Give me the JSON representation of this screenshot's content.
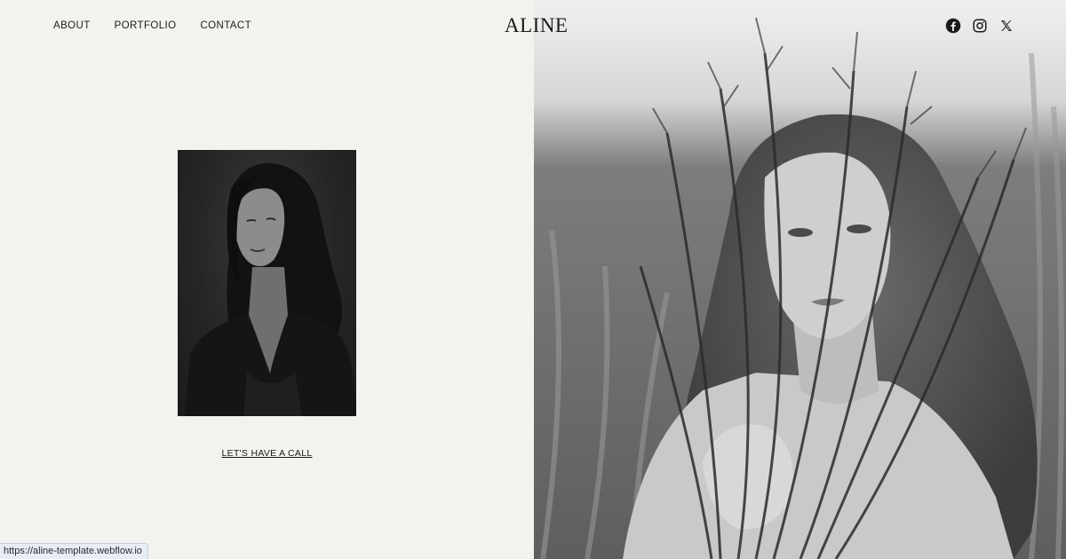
{
  "nav": {
    "items": [
      {
        "label": "ABOUT"
      },
      {
        "label": "PORTFOLIO"
      },
      {
        "label": "CONTACT"
      }
    ]
  },
  "brand": {
    "logo_text": "ALINE"
  },
  "social": {
    "icons": [
      "facebook-icon",
      "instagram-icon",
      "x-twitter-icon"
    ]
  },
  "hero": {
    "cta_label": "LET'S HAVE A CALL",
    "portrait_alt": "Black and white portrait of woman with long dark hair",
    "feature_image_alt": "Black and white photo of woman with curly hair holding tall grass"
  },
  "browser": {
    "status_url": "https://aline-template.webflow.io"
  },
  "colors": {
    "background": "#f3f2ee",
    "text": "#1a1a1a"
  }
}
